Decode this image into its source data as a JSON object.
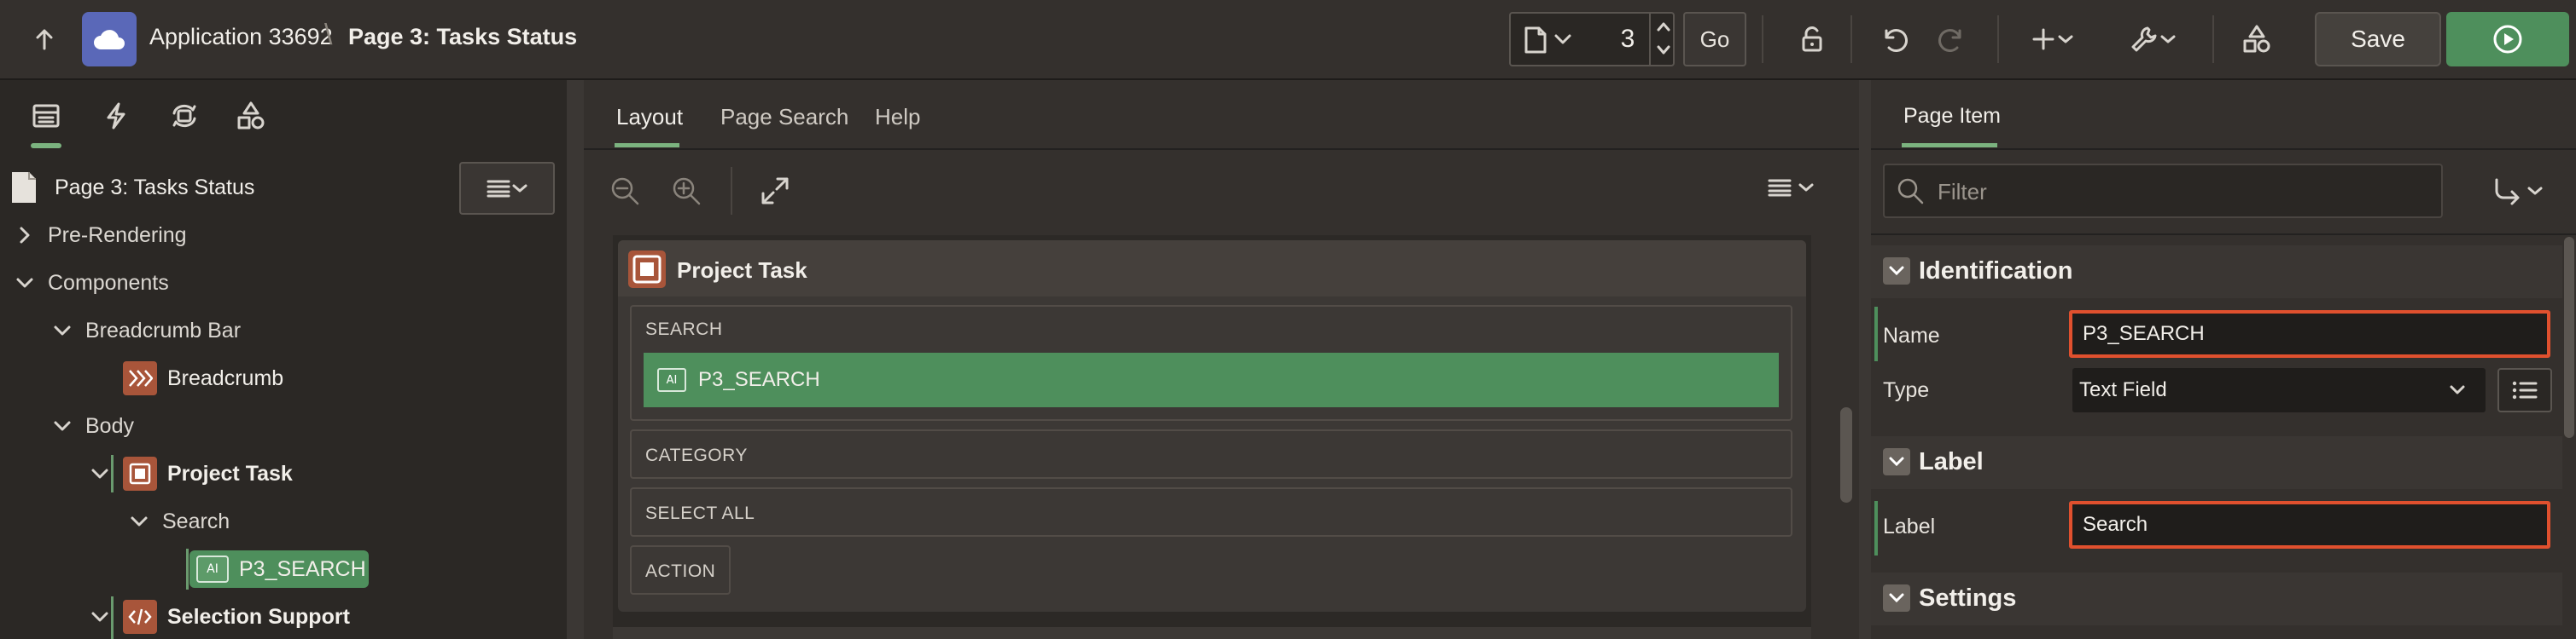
{
  "header": {
    "app_name": "Application 33692",
    "crumb_separator": "\\",
    "page_name": "Page 3: Tasks Status",
    "page_number": "3",
    "go_label": "Go",
    "save_label": "Save",
    "icons": [
      "arrow-up-icon",
      "app-cloud-icon",
      "page-icon",
      "chevron-down-icon",
      "stepper-up-icon",
      "stepper-down-icon",
      "lock-icon",
      "undo-icon",
      "redo-icon",
      "plus-icon",
      "wrench-icon",
      "shapes-icon",
      "play-icon"
    ],
    "colors": {
      "app_logo": "#5a68b8",
      "run_button": "#4e8f5c"
    }
  },
  "left_panel": {
    "tabs": [
      "rendering-tab",
      "dynamic-actions-tab",
      "processing-tab",
      "shared-components-tab"
    ],
    "tree_header": "Page 3: Tasks Status",
    "tree": [
      {
        "label": "Pre-Rendering",
        "expanded": false
      },
      {
        "label": "Components",
        "expanded": true
      },
      {
        "label": "Breadcrumb Bar",
        "expanded": true
      },
      {
        "label": "Breadcrumb"
      },
      {
        "label": "Body",
        "expanded": true
      },
      {
        "label": "Project Task",
        "expanded": true
      },
      {
        "label": "Search",
        "expanded": true
      },
      {
        "label": "P3_SEARCH",
        "selected": true
      },
      {
        "label": "Selection Support",
        "expanded": true
      }
    ]
  },
  "center_panel": {
    "tabs": [
      "Layout",
      "Page Search",
      "Help"
    ],
    "active_tab": "Layout",
    "region_title": "Project Task",
    "slots": [
      {
        "label": "SEARCH"
      },
      {
        "label": "CATEGORY"
      },
      {
        "label": "SELECT ALL"
      },
      {
        "label": "ACTION"
      }
    ],
    "item": "P3_SEARCH"
  },
  "right_panel": {
    "tab": "Page Item",
    "filter_placeholder": "Filter",
    "groups": {
      "identification": "Identification",
      "label": "Label",
      "settings": "Settings"
    },
    "props": {
      "name_label": "Name",
      "name_value": "P3_SEARCH",
      "type_label": "Type",
      "type_value": "Text Field",
      "label_label": "Label",
      "label_value": "Search"
    },
    "colors": {
      "highlight_border": "#e0502e"
    }
  }
}
